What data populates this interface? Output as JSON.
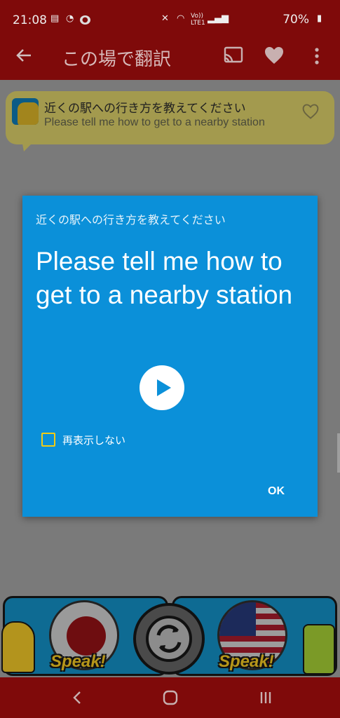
{
  "status_bar": {
    "time": "21:08",
    "network": "Vo))\nLTE1",
    "battery": "70%"
  },
  "app_bar": {
    "title": "この場で翻訳",
    "icons": [
      "back-arrow-icon",
      "cast-icon",
      "heart-icon",
      "more-vert-icon"
    ]
  },
  "phrase_bubble": {
    "japanese": "近くの駅への行き方を教えてください",
    "english": "Please tell me how to get to a nearby station"
  },
  "dialog": {
    "subtitle": "近くの駅への行き方を教えてください",
    "translation": "Please tell me how to get to a nearby station",
    "checkbox_label": "再表示しない",
    "checkbox_checked": false,
    "ok_label": "OK"
  },
  "speak_bar": {
    "left_label": "Speak!",
    "right_label": "Speak!"
  },
  "colors": {
    "app_bar": "#7f0a0a",
    "dialog": "#0b90d9",
    "checkbox": "#f2cc14"
  }
}
